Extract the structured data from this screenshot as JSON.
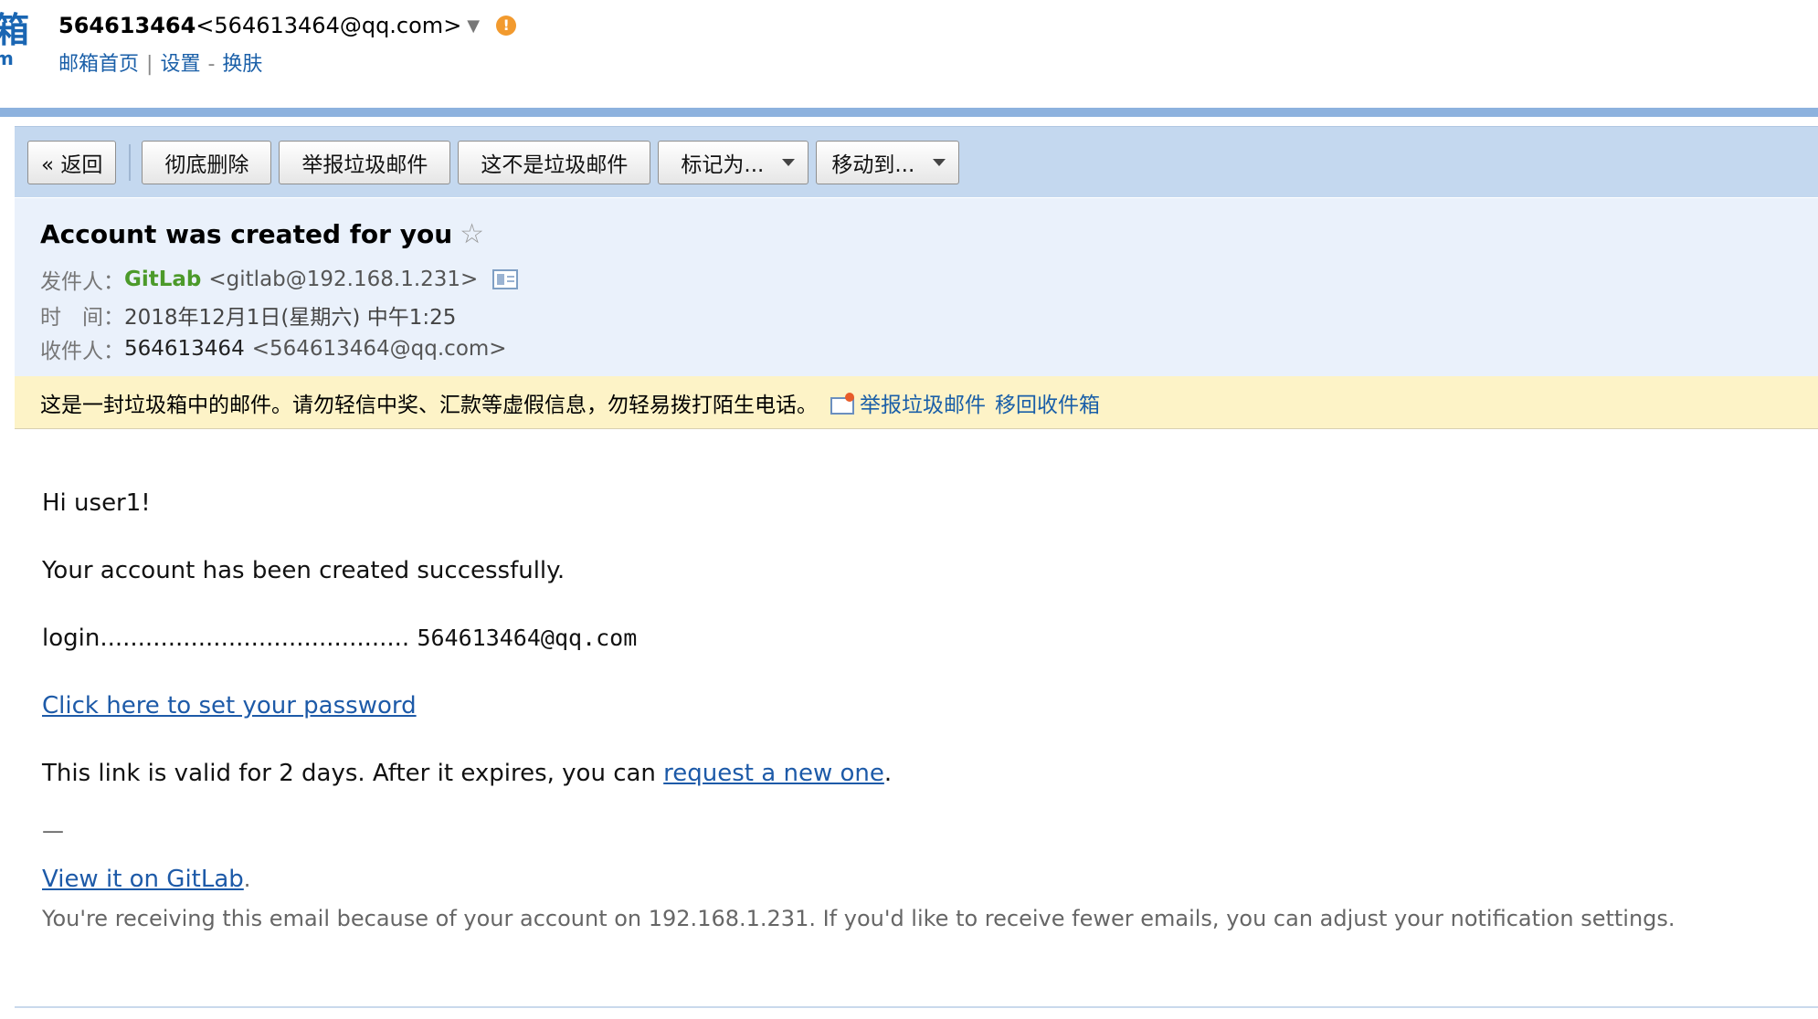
{
  "header": {
    "logo_big": "箱",
    "logo_small": "m",
    "account_id": "564613464",
    "account_address": "<564613464@qq.com>",
    "dropdown_glyph": "▼",
    "alert_glyph": "!",
    "links": {
      "home": "邮箱首页",
      "settings": "设置",
      "skin_separator": "-",
      "skin": "换肤"
    }
  },
  "toolbar": {
    "back": "« 返回",
    "delete_permanently": "彻底删除",
    "report_spam": "举报垃圾邮件",
    "not_spam": "这不是垃圾邮件",
    "mark_as": "标记为...",
    "move_to": "移动到..."
  },
  "mail": {
    "subject": "Account was created for you",
    "star_glyph": "☆",
    "from_label": "发件人：",
    "from_name": "GitLab",
    "from_address": "<gitlab@192.168.1.231>",
    "time_label": "时　间：",
    "time_value": "2018年12月1日(星期六) 中午1:25",
    "to_label": "收件人：",
    "to_name": "564613464",
    "to_address": "<564613464@qq.com>"
  },
  "spam_warning": {
    "text": "这是一封垃圾箱中的邮件。请勿轻信中奖、汇款等虚假信息，勿轻易拨打陌生电话。",
    "report_link": "举报垃圾邮件",
    "move_back_link": "移回收件箱"
  },
  "body": {
    "greeting": "Hi user1!",
    "created": "Your account has been created successfully.",
    "login_label": "login.........................................",
    "login_value": "564613464@qq.com",
    "set_password_link": "Click here to set your password",
    "validity_prefix": "This link is valid for 2 days. After it expires, you can ",
    "request_link": "request a new one",
    "validity_suffix": ".",
    "dash": "—",
    "view_link": "View it on GitLab",
    "view_suffix": ".",
    "notice": "You're receiving this email because of your account on 192.168.1.231. If you'd like to receive fewer emails, you can adjust your notification settings."
  },
  "colors": {
    "accent_blue": "#1a5fa8",
    "toolbar_bg": "#c4d8ef",
    "head_bg": "#eaf1fb",
    "warning_bg": "#fdf3c7",
    "sender_green": "#4c9a2a",
    "alert_orange": "#f29a2e"
  },
  "icons": {
    "dropdown": "chevron-down-icon",
    "alert": "alert-icon",
    "star": "star-icon",
    "contact_card": "contact-card-icon",
    "spam_report": "spam-report-icon"
  }
}
